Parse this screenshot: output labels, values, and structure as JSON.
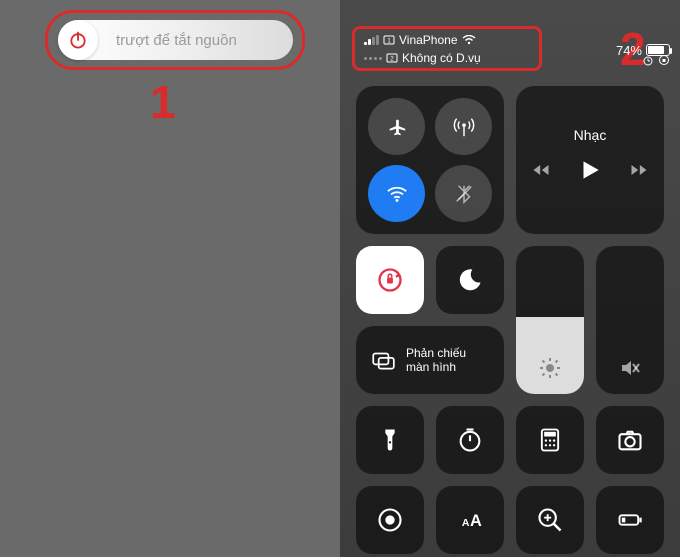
{
  "left": {
    "slider_text": "trượt để tắt nguồn",
    "label": "1"
  },
  "right": {
    "label": "2",
    "status": {
      "carrier1": "VinaPhone",
      "carrier2": "Không có D.vụ",
      "battery_text": "74%",
      "battery_level": 74
    },
    "music": {
      "title": "Nhạc"
    },
    "mirror": {
      "label": "Phản chiếu màn hình"
    },
    "brightness_level": 52,
    "volume_level": 0
  }
}
